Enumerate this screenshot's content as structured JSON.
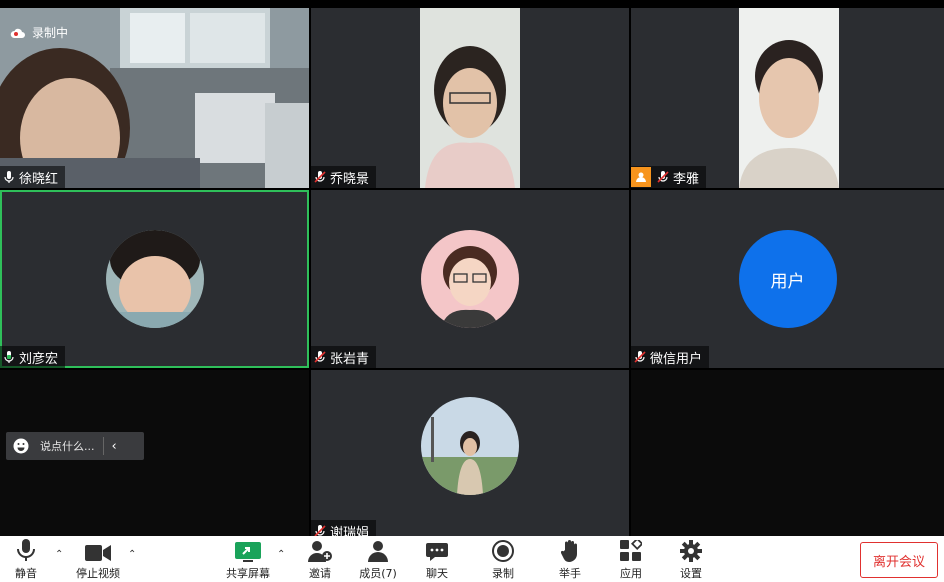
{
  "meeting": {
    "recording_label": "录制中",
    "participants": [
      {
        "name": "徐晓红",
        "mic": "active"
      },
      {
        "name": "乔晓景",
        "mic": "muted"
      },
      {
        "name": "李雅",
        "mic": "muted",
        "badge": "host"
      },
      {
        "name": "刘彦宏",
        "mic": "active",
        "speaking": true
      },
      {
        "name": "张岩青",
        "mic": "muted"
      },
      {
        "name": "微信用户",
        "mic": "muted",
        "avatar_text": "用户"
      },
      {
        "name": "谢瑞娟",
        "mic": "muted"
      }
    ]
  },
  "chat": {
    "placeholder": "说点什么..."
  },
  "toolbar": {
    "mute": "静音",
    "stop_video": "停止视频",
    "share_screen": "共享屏幕",
    "invite": "邀请",
    "members": "成员(7)",
    "chat": "聊天",
    "record": "录制",
    "raise_hand": "举手",
    "apps": "应用",
    "settings": "设置",
    "leave": "离开会议"
  },
  "colors": {
    "accent_blue": "#0e71eb",
    "leave_red": "#e0312f",
    "active_speaker_green": "#2fbf5a",
    "host_badge_orange": "#f7941d"
  }
}
